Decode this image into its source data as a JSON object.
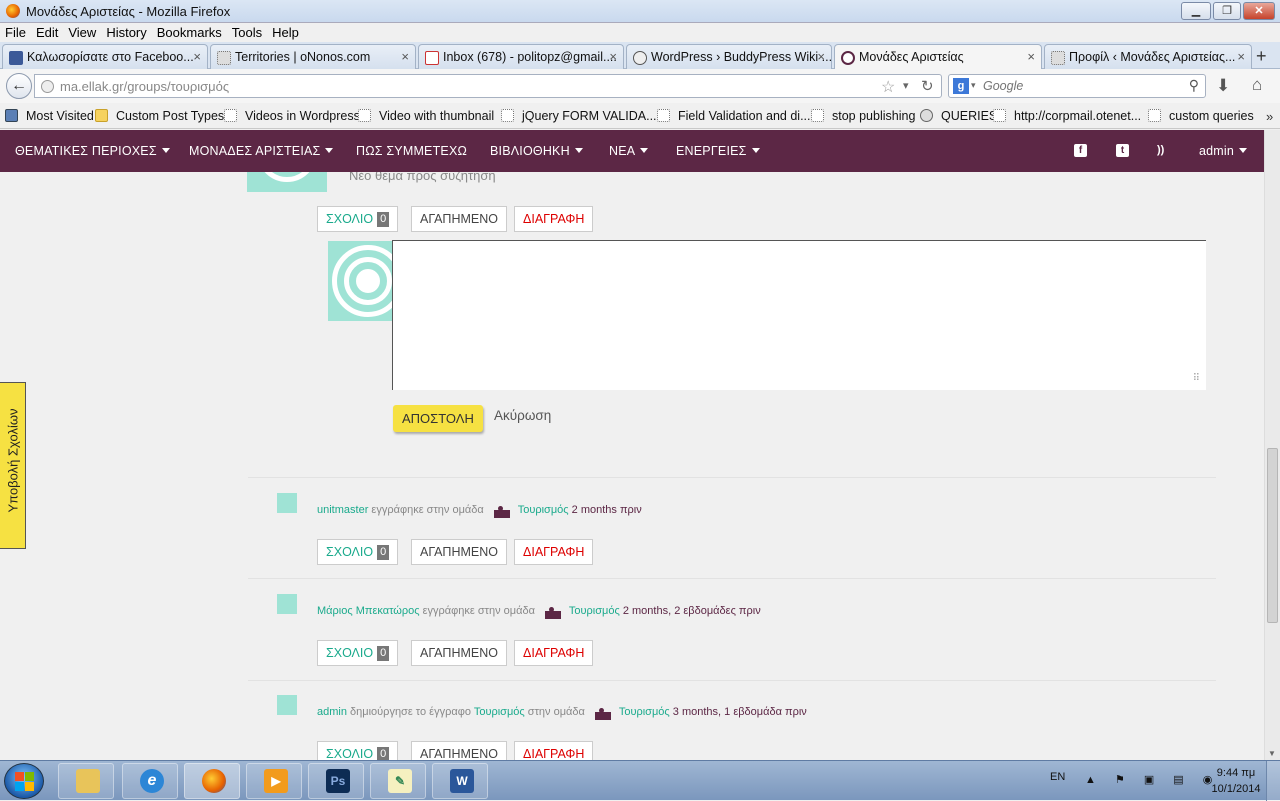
{
  "window": {
    "title": "Μονάδες Αριστείας - Mozilla Firefox",
    "minimize": "▁",
    "restore": "❐",
    "close": "✕"
  },
  "menubar": [
    "File",
    "Edit",
    "View",
    "History",
    "Bookmarks",
    "Tools",
    "Help"
  ],
  "tabs": [
    {
      "label": "Καλωσορίσατε στο Faceboo...",
      "close": "×"
    },
    {
      "label": "Territories | oNonos.com",
      "close": "×"
    },
    {
      "label": "Inbox (678) - politopz@gmail....",
      "close": "×"
    },
    {
      "label": "WordPress › BuddyPress Wiki ...",
      "close": "×"
    },
    {
      "label": "Μονάδες Αριστείας",
      "close": "×"
    },
    {
      "label": "Προφίλ ‹ Μονάδες Αριστείας...",
      "close": "×"
    }
  ],
  "newtab": "+",
  "nav": {
    "url": "ma.ellak.gr/groups/τουρισμός",
    "search_placeholder": "Google",
    "back": "←",
    "star": "☆",
    "reload": "↻",
    "search_icon": "⚲",
    "download": "⬇",
    "home": "⌂",
    "engine": "g",
    "engine_drop": "▾",
    "url_drop": "▾"
  },
  "bookmarks": [
    "Most Visited",
    "Custom Post Types",
    "Videos in Wordpress",
    "Video with thumbnail",
    "jQuery FORM VALIDA...",
    "Field Validation and di...",
    "stop publishing",
    "QUERIES",
    "http://corpmail.otenet...",
    "custom queries"
  ],
  "bookmarks_more": "»",
  "sitenav": {
    "items": [
      "ΘΕΜΑΤΙΚΕΣ ΠΕΡΙΟΧΕΣ",
      "ΜΟΝΑΔΕΣ ΑΡΙΣΤΕΙΑΣ",
      "ΠΩΣ ΣΥΜΜΕΤΕΧΩ",
      "ΒΙΒΛΙΟΘΗΚΗ",
      "ΝΕΑ",
      "ΕΝΕΡΓΕΙΕΣ"
    ],
    "user": "admin",
    "icons": {
      "facebook": "f",
      "twitter": "t",
      "rss": "))"
    }
  },
  "content": {
    "top_text": "Νέο θέμα προς συζήτηση",
    "actions": {
      "comment": "ΣΧΟΛΙΟ",
      "comment_count": "0",
      "favorite": "ΑΓΑΠΗΜΕΝΟ",
      "delete": "ΔΙΑΓΡΑΦΗ"
    },
    "reply": {
      "send": "ΑΠΟΣΤΟΛΗ",
      "cancel": "Ακύρωση",
      "resize": "⠿"
    },
    "activities": [
      {
        "user": "unitmaster",
        "verb": "εγγράφηκε στην ομάδα",
        "group": "Τουρισμός",
        "time": "2 months πριν"
      },
      {
        "user": "Μάριος Μπεκατώρος",
        "verb": "εγγράφηκε στην ομάδα",
        "group": "Τουρισμός",
        "time": "2 months, 2 εβδομάδες πριν"
      },
      {
        "user": "admin",
        "verb": "δημιούργησε το έγγραφο",
        "doc": "Τουρισμός",
        "verb2": "στην ομάδα",
        "group": "Τουρισμός",
        "time": "3 months, 1 εβδομάδα πριν"
      }
    ]
  },
  "sidetab": "Υποβολή Σχολίων",
  "taskbar": {
    "lang": "EN",
    "time": "9:44 πμ",
    "date": "10/1/2014",
    "tray_icons": "▲ ⚑ ▣ ▤ ◉",
    "apps": [
      "Explorer",
      "IE",
      "Firefox",
      "Media",
      "Ps",
      "Notes",
      "W"
    ]
  }
}
